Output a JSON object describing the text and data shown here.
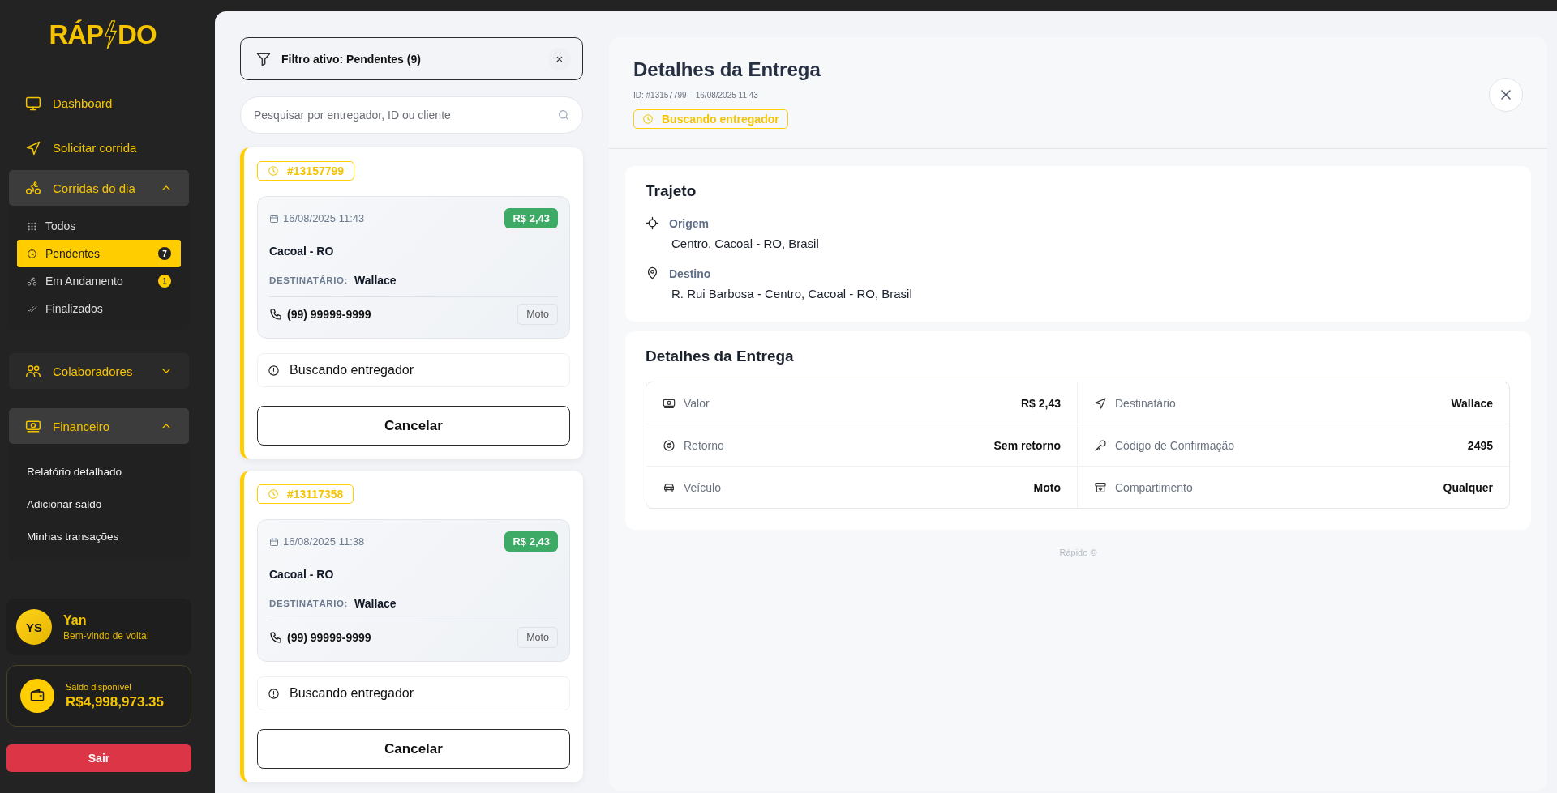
{
  "sidebar": {
    "logo": {
      "left": "RÁP",
      "right": "DO"
    },
    "nav": [
      {
        "label": "Dashboard",
        "kind": "link"
      },
      {
        "label": "Solicitar corrida",
        "kind": "link"
      },
      {
        "label": "Corridas do dia",
        "kind": "group",
        "expanded": true,
        "children": [
          {
            "label": "Todos",
            "selected": false
          },
          {
            "label": "Pendentes",
            "selected": true,
            "count": "7"
          },
          {
            "label": "Em Andamento",
            "selected": false,
            "count": "1"
          },
          {
            "label": "Finalizados",
            "selected": false
          }
        ]
      },
      {
        "label": "Colaboradores",
        "kind": "group",
        "expanded": false
      },
      {
        "label": "Financeiro",
        "kind": "group",
        "expanded": true,
        "children": [
          {
            "label": "Relatório detalhado",
            "selected": false
          },
          {
            "label": "Adicionar saldo",
            "selected": false
          },
          {
            "label": "Minhas transações",
            "selected": false
          }
        ]
      }
    ],
    "user": {
      "initials": "YS",
      "name": "Yan",
      "greeting": "Bem-vindo de volta!"
    },
    "balance": {
      "label": "Saldo disponível",
      "amount": "R$4,998,973.35"
    },
    "logout": "Sair"
  },
  "filter": {
    "label": "Filtro ativo: Pendentes (9)",
    "close": "×"
  },
  "search": {
    "placeholder": "Pesquisar por entregador, ID ou cliente"
  },
  "deliveries": [
    {
      "id": "#13157799",
      "date": "16/08/2025 11:43",
      "price": "R$ 2,43",
      "city": "Cacoal - RO",
      "recipient_label": "DESTINATÁRIO:",
      "recipient": "Wallace",
      "phone": "(99) 99999-9999",
      "vehicle": "Moto",
      "status": "Buscando entregador",
      "cancel": "Cancelar"
    },
    {
      "id": "#13117358",
      "date": "16/08/2025 11:38",
      "price": "R$ 2,43",
      "city": "Cacoal - RO",
      "recipient_label": "DESTINATÁRIO:",
      "recipient": "Wallace",
      "phone": "(99) 99999-9999",
      "vehicle": "Moto",
      "status": "Buscando entregador",
      "cancel": "Cancelar"
    }
  ],
  "detail": {
    "title": "Detalhes da Entrega",
    "meta": "ID: #13157799 – 16/08/2025 11:43",
    "status": "Buscando entregador",
    "route": {
      "title": "Trajeto",
      "stops": [
        {
          "label": "Origem",
          "address": "Centro, Cacoal - RO, Brasil"
        },
        {
          "label": "Destino",
          "address": "R. Rui Barbosa - Centro, Cacoal - RO, Brasil"
        }
      ]
    },
    "info": {
      "title": "Detalhes da Entrega",
      "rows": [
        {
          "label": "Valor",
          "value": "R$ 2,43"
        },
        {
          "label": "Destinatário",
          "value": "Wallace"
        },
        {
          "label": "Retorno",
          "value": "Sem retorno"
        },
        {
          "label": "Código de Confirmação",
          "value": "2495"
        },
        {
          "label": "Veículo",
          "value": "Moto"
        },
        {
          "label": "Compartimento",
          "value": "Qualquer"
        }
      ]
    }
  },
  "footer": "Rápido ©"
}
